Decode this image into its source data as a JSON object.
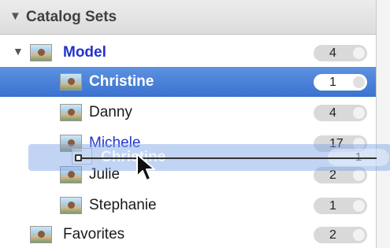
{
  "panel": {
    "title": "Catalog Sets",
    "header_disclosure": "▼"
  },
  "rows": [
    {
      "label": "Model",
      "count": "4",
      "disclosure": "▼",
      "state": "expanded"
    },
    {
      "label": "Christine",
      "count": "1",
      "state": "selected"
    },
    {
      "label": "Danny",
      "count": "4"
    },
    {
      "label": "Michele",
      "count": "17",
      "state": "drop-target"
    },
    {
      "label": "Julie",
      "count": "2"
    },
    {
      "label": "Stephanie",
      "count": "1"
    },
    {
      "label": "Favorites",
      "count": "2"
    }
  ],
  "drag": {
    "label": "Christine",
    "count": "1"
  },
  "colors": {
    "selection": "#3a72cf",
    "link_blue": "#2233cc",
    "header_bg": "#dcdcdc"
  },
  "icons": {
    "disclosure": "disclosure-triangle-icon",
    "thumbnail": "photo-thumbnail-icon",
    "cursor": "arrow-cursor-icon"
  }
}
